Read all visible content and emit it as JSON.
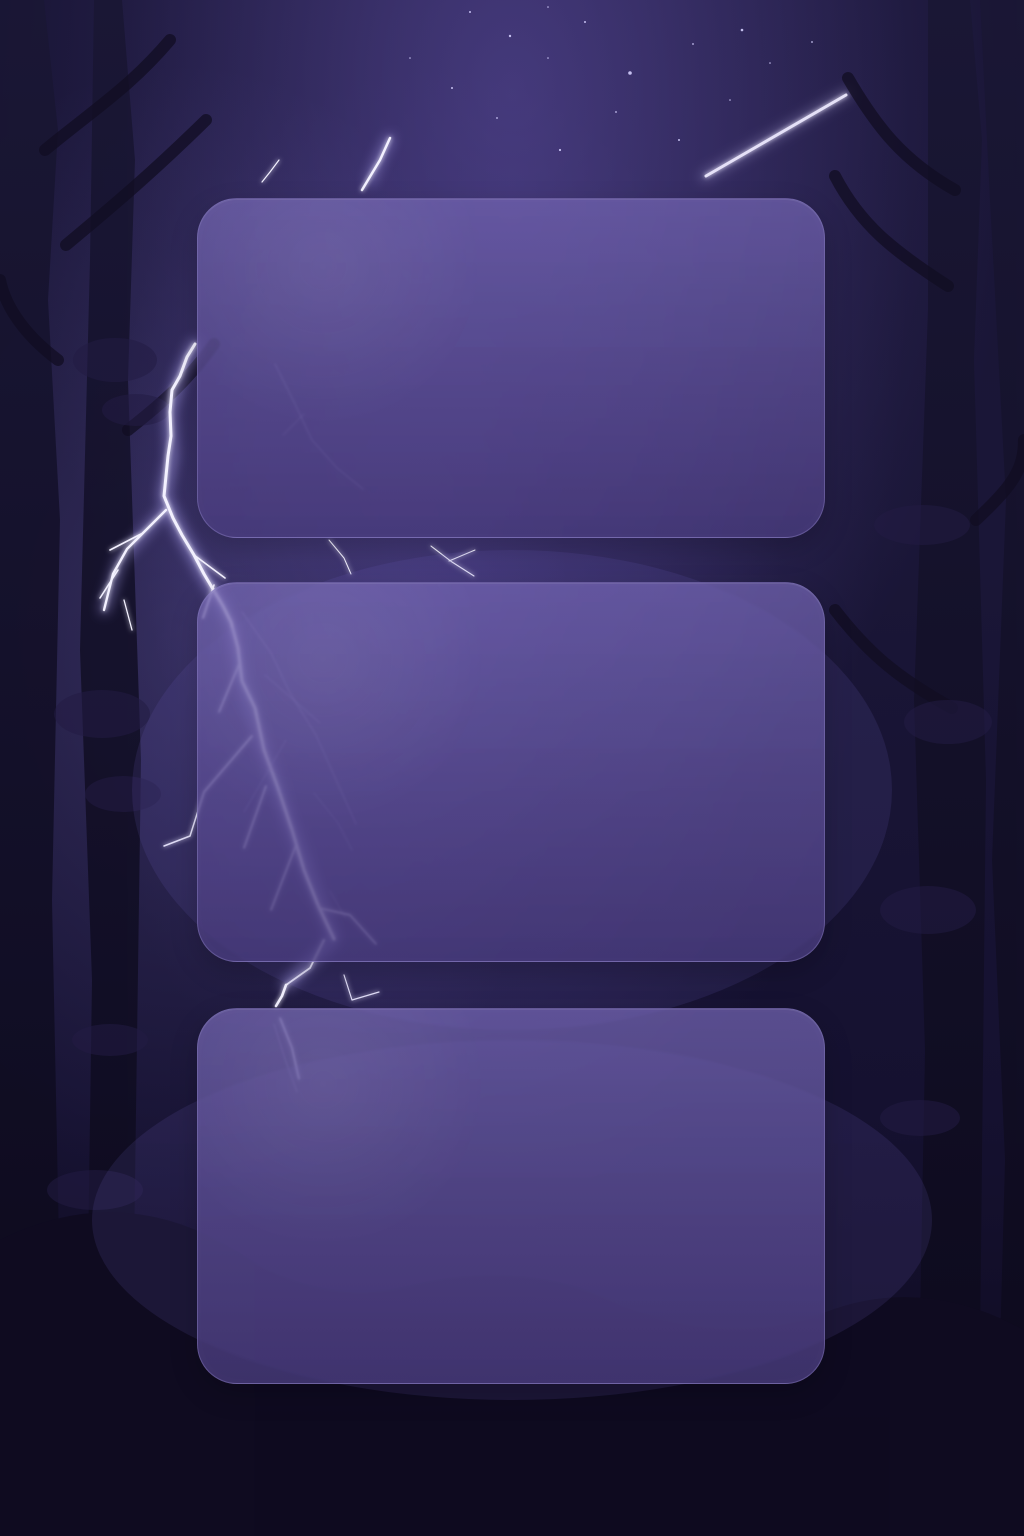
{
  "screen": {
    "panels": [
      {},
      {},
      {}
    ]
  }
}
